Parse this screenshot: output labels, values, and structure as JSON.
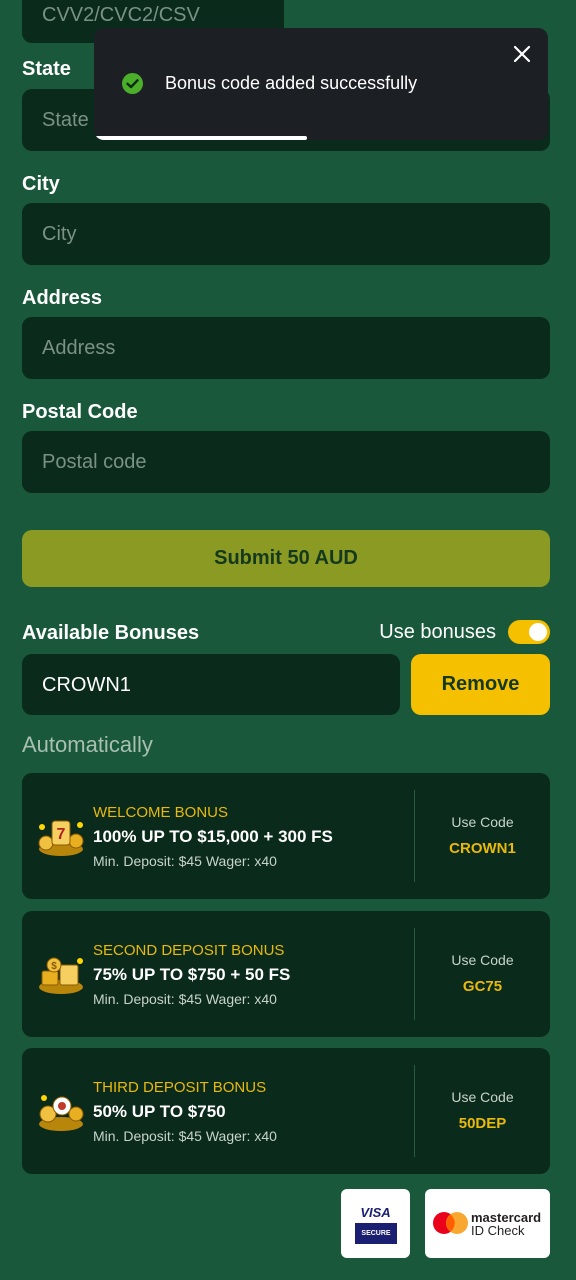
{
  "form": {
    "cvv_placeholder": "CVV2/CVC2/CSV",
    "state_label": "State",
    "state_placeholder": "State",
    "city_label": "City",
    "city_placeholder": "City",
    "address_label": "Address",
    "address_placeholder": "Address",
    "postal_label": "Postal Code",
    "postal_placeholder": "Postal code",
    "submit_label": "Submit 50 AUD"
  },
  "bonuses": {
    "title": "Available Bonuses",
    "use_bonuses_label": "Use bonuses",
    "use_bonuses_on": true,
    "code_value": "CROWN1",
    "remove_label": "Remove",
    "auto_label": "Automatically",
    "use_code_label": "Use Code",
    "items": [
      {
        "type": "WELCOME BONUS",
        "main": "100% UP TO $15,000 + 300 FS",
        "terms": "Min. Deposit: $45 Wager: x40",
        "code": "CROWN1",
        "icon": "slot-7s-icon"
      },
      {
        "type": "SECOND DEPOSIT BONUS",
        "main": "75% UP TO $750 + 50 FS",
        "terms": "Min. Deposit: $45 Wager: x40",
        "code": "GC75",
        "icon": "gold-stack-icon"
      },
      {
        "type": "THIRD DEPOSIT BONUS",
        "main": "50% UP TO $750",
        "terms": "Min. Deposit: $45 Wager: x40",
        "code": "50DEP",
        "icon": "casino-chips-icon"
      }
    ]
  },
  "payment": {
    "visa_text": "VISA",
    "visa_sub": "SECURE",
    "mc_text": "mastercard",
    "mc_sub": "ID Check"
  },
  "toast": {
    "message": "Bonus code added successfully",
    "progress": 0.47
  },
  "colors": {
    "background": "#19583a",
    "input": "#0a2a1b",
    "accent": "#f5c000",
    "submit": "#8a9a23",
    "bonus_gold": "#e9b90c"
  }
}
